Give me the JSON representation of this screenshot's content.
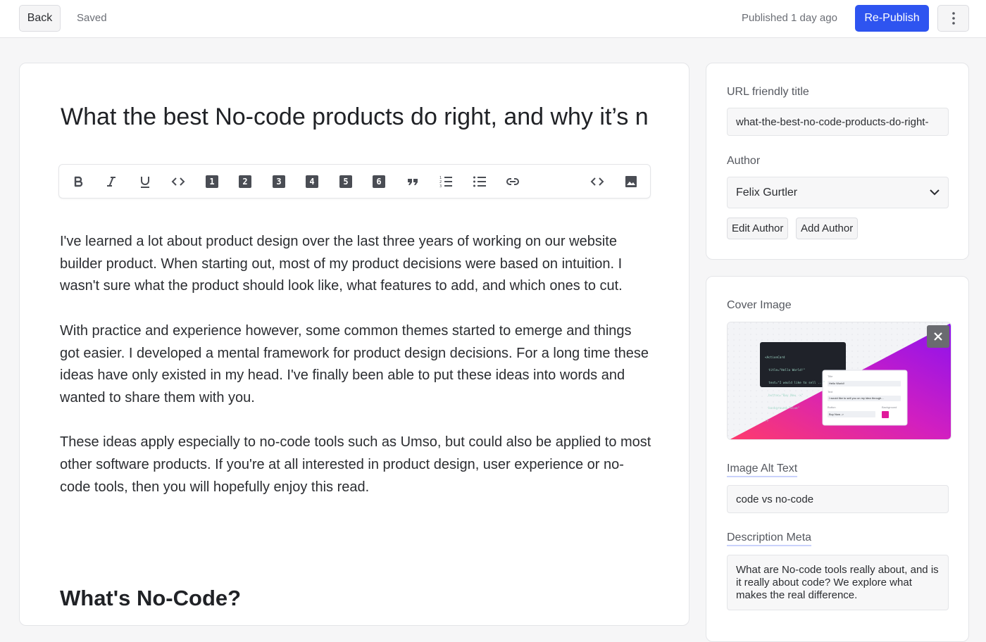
{
  "topbar": {
    "back_label": "Back",
    "saved_status": "Saved",
    "published_status": "Published 1 day ago",
    "republish_label": "Re-Publish",
    "more_icon": "vertical-dots-icon"
  },
  "editor": {
    "title": "What the best No-code products do right, and why it’s n",
    "toolbar": [
      {
        "name": "bold-icon"
      },
      {
        "name": "italic-icon"
      },
      {
        "name": "underline-icon"
      },
      {
        "name": "inline-code-icon"
      },
      {
        "name": "heading-1-icon",
        "label": "1"
      },
      {
        "name": "heading-2-icon",
        "label": "2"
      },
      {
        "name": "heading-3-icon",
        "label": "3"
      },
      {
        "name": "heading-4-icon",
        "label": "4"
      },
      {
        "name": "heading-5-icon",
        "label": "5"
      },
      {
        "name": "heading-6-icon",
        "label": "6"
      },
      {
        "name": "quote-icon"
      },
      {
        "name": "numbered-list-icon"
      },
      {
        "name": "bulleted-list-icon"
      },
      {
        "name": "link-icon"
      },
      {
        "name": "code-block-icon"
      },
      {
        "name": "image-icon"
      }
    ],
    "paragraphs": [
      "I've learned a lot about product design over the last three years of working on our website builder product. When starting out, most of my product decisions were based on intuition. I wasn't sure what the product should look like, what features to add, and which ones to cut.",
      "With practice and experience however, some common themes started to emerge and things got easier. I developed a mental framework for product design decisions. For a long time these ideas have only existed in my head. I've finally been able to put these ideas into words and wanted to share them with you.",
      "These ideas apply especially to no-code tools such as Umso, but could also be applied to most other software products. If you're at all interested in product design, user experience or no-code tools, then you will hopefully enjoy this read."
    ],
    "heading": "What's No-Code?"
  },
  "settings": {
    "url_label": "URL friendly title",
    "url_value": "what-the-best-no-code-products-do-right-",
    "author_label": "Author",
    "author_value": "Felix Gurtler",
    "edit_author_label": "Edit Author",
    "add_author_label": "Add Author"
  },
  "cover": {
    "label": "Cover Image",
    "remove_icon": "close-icon",
    "alt_label": "Image Alt Text",
    "alt_value": "code vs no-code",
    "desc_label": "Description Meta",
    "desc_value": "What are No-code tools really about, and is it really about code? We explore what makes the real difference.",
    "mock_code": [
      "<ActionCard",
      "  title=\"Hello World!\"",
      "  text=\"I would like to sell ...\"",
      "  button=\"Buy Now ->\"",
      "  background=\"blue\"",
      "/>"
    ],
    "mock_form": {
      "title_label": "Title",
      "title_value": "Hello World!",
      "text_label": "Text",
      "text_value": "I would like to sell you on my idea through...",
      "button_label": "Button",
      "button_value": "Buy Now ->",
      "background_label": "Background"
    }
  }
}
